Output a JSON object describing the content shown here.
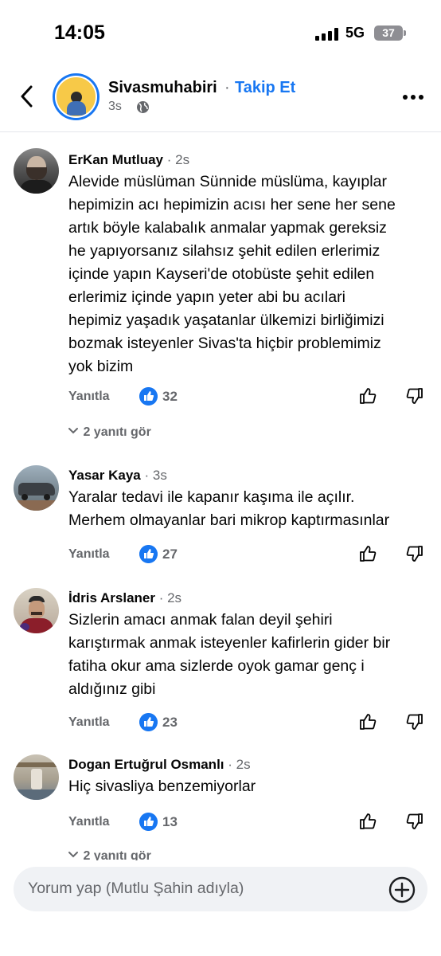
{
  "status_bar": {
    "time": "14:05",
    "network": "5G",
    "battery": "37"
  },
  "post": {
    "page_name": "Sivasmuhabiri",
    "separator": "·",
    "follow_label": "Takip Et",
    "time": "3s"
  },
  "comments": [
    {
      "name": "ErKan Mutluay",
      "time": "· 2s",
      "text": "Alevide müslüman Sünnide müslüma,  kayıplar\nhepimizin acı hepimizin acısı her sene her sene\nartık böyle kalabalık anmalar yapmak gereksiz\nhe yapıyorsanız silahsız şehit edilen erlerimiz\niçinde yapın Kayseri'de otobüste şehit edilen\nerlerimiz içinde yapın yeter abi bu acılari\nhepimiz yaşadık yaşatanlar ülkemizi birliğimizi\nbozmak isteyenler Sivas'ta hiçbir problemimiz\nyok bizim",
      "reply_label": "Yanıtla",
      "like_count": "32",
      "more_replies": "2 yanıtı gör"
    },
    {
      "name": "Yasar Kaya",
      "time": "· 3s",
      "text": "Yaralar tedavi ile kapanır kaşıma ile açılır.\nMerhem olmayanlar bari mikrop kaptırmasınlar",
      "reply_label": "Yanıtla",
      "like_count": "27"
    },
    {
      "name": "İdris Arslaner",
      "time": "· 2s",
      "text": "Sizlerin amacı anmak falan deyil şehiri\nkarıştırmak anmak isteyenler kafirlerin gider bir\nfatiha okur ama sizlerde oyok gamar genç i\naldığınız gibi",
      "reply_label": "Yanıtla",
      "like_count": "23"
    },
    {
      "name": "Dogan Ertuğrul Osmanlı",
      "time": "· 2s",
      "text": "Hiç sivasliya benzemiyorlar",
      "reply_label": "Yanıtla",
      "like_count": "13",
      "more_replies": "2 yanıtı gör"
    }
  ],
  "composer": {
    "placeholder": "Yorum yap (Mutlu Şahin adıyla)"
  },
  "icons": {
    "back": "chevron-left-icon",
    "globe": "globe-icon",
    "more": "more-horizontal-icon",
    "like": "like-badge-icon",
    "thumb_up": "thumbs-up-outline-icon",
    "thumb_down": "thumbs-down-outline-icon",
    "expand": "chevron-down-icon",
    "add": "plus-circle-icon"
  },
  "colors": {
    "accent": "#1877f2",
    "secondary_text": "#65676b",
    "divider": "#e4e6eb",
    "composer_bg": "#f0f2f5"
  }
}
